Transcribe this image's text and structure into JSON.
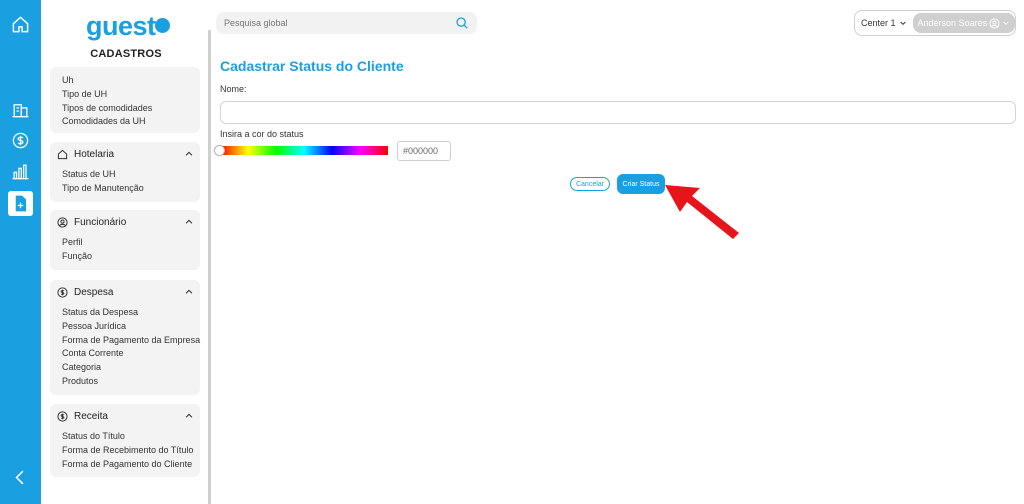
{
  "app": {
    "logo_text": "guest",
    "section_title": "CADASTROS"
  },
  "rail": {
    "items": [
      {
        "icon": "home-icon"
      },
      {
        "icon": "building-icon"
      },
      {
        "icon": "dollar-icon"
      },
      {
        "icon": "bar-chart-icon"
      },
      {
        "icon": "document-add-icon",
        "active": true
      },
      {
        "icon": "chevron-left-icon"
      }
    ]
  },
  "sidebar": {
    "uh_group": {
      "items": [
        "Uh",
        "Tipo de UH",
        "Tipos de comodidades",
        "Comodidades da UH"
      ]
    },
    "hotelaria": {
      "label": "Hotelaria",
      "items": [
        "Status de UH",
        "Tipo de Manutenção"
      ]
    },
    "funcionario": {
      "label": "Funcionário",
      "items": [
        "Perfil",
        "Função"
      ]
    },
    "despesa": {
      "label": "Despesa",
      "items": [
        "Status da Despesa",
        "Pessoa Jurídica",
        "Forma de Pagamento da Empresa",
        "Conta Corrente",
        "Categoria",
        "Produtos"
      ]
    },
    "receita": {
      "label": "Receita",
      "items": [
        "Status do Título",
        "Forma de Recebimento do Título",
        "Forma de Pagamento do Cliente"
      ]
    }
  },
  "header": {
    "search_placeholder": "Pesquisa global",
    "center_label": "Center 1",
    "user_name": "Anderson Soares"
  },
  "form": {
    "title": "Cadastrar Status do Cliente",
    "name_label": "Nome:",
    "name_value": "",
    "color_label": "Insira a cor do status",
    "color_value": "#000000",
    "cancel_label": "Cancelar",
    "submit_label": "Criar Status"
  },
  "colors": {
    "brand": "#1a9fe0",
    "annotation_arrow": "#e8141c"
  }
}
